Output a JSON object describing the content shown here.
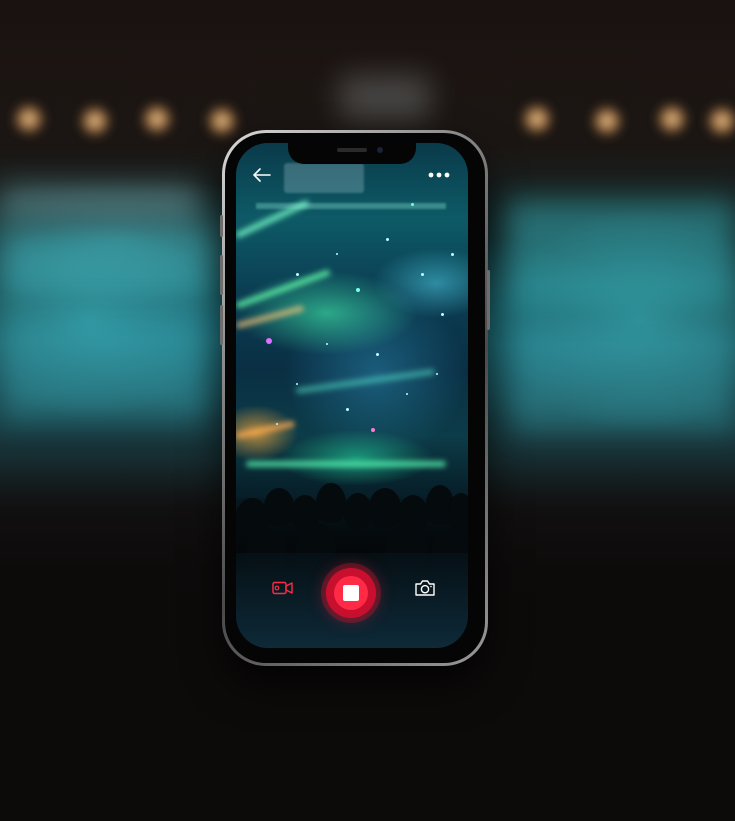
{
  "screen": {
    "title": "",
    "background_scene": "concert-crowd-stage-lights"
  },
  "top_bar": {
    "back_icon": "arrow-left-icon",
    "more_icon": "more-horizontal-icon"
  },
  "camera_controls": {
    "video_mode_icon": "video-camera-icon",
    "video_mode_active": true,
    "record_state": "recording",
    "record_icon": "stop-square-icon",
    "photo_mode_icon": "camera-icon"
  },
  "colors": {
    "accent": "#ff2a46",
    "record_ring": "#c8102e",
    "icon_light": "#ffffff"
  }
}
